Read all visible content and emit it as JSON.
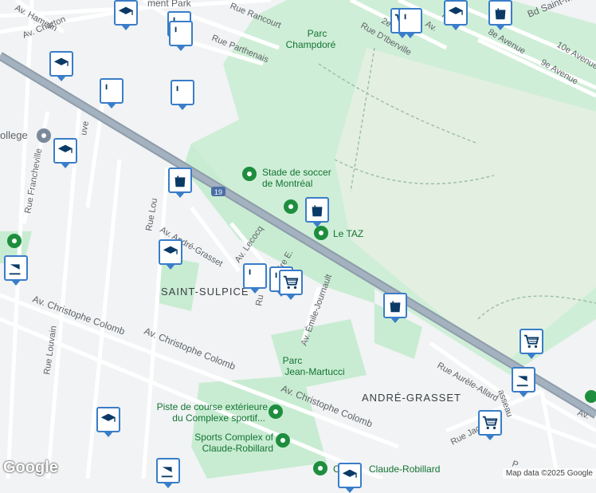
{
  "labels": {
    "street_hamelin": "Av. Hamelin",
    "street_charton": "Av. Charton",
    "street_rancourt": "Rue Rancourt",
    "street_parthenais": "Rue Parthenais",
    "street_iberville": "Rue D'Iberville",
    "street_2e": "2e",
    "street_7e": "7e",
    "street_av": "Av.",
    "street_8e": "8e Avenue",
    "street_9e": "9e Avenue",
    "street_10e": "10e Avenue",
    "street_stmichel": "Bd Saint-Michel",
    "street_louvain": "Rue Louvain",
    "street_lou": "Rue Lou",
    "street_francheville": "Rue Francheville",
    "street_uve": "uve",
    "street_andregrasset": "Av. André-Grasset",
    "street_lecocq": "Av. Lecocq",
    "street_ire": "ire E.",
    "street_ru": "Ru",
    "street_journault": "Av. Émile-Journault",
    "street_colomb1": "Av. Christophe Colomb",
    "street_colomb2": "Av. Christophe Colomb",
    "street_colomb3": "Av. Christophe Colomb",
    "street_allard": "Rue Aurèle-Allard",
    "street_jacques": "Rue Jac",
    "street_rasseau": "asseau",
    "street_av_right": "Av.",
    "street_p": "P",
    "street_ollege": "ollege",
    "hwy_19": "19",
    "hood_stsulpice": "SAINT-SULPICE",
    "hood_andregrasset": "ANDRÉ-GRASSET",
    "park_champdore_1": "Parc",
    "park_champdore_2": "Champdoré",
    "park_martucci_1": "Parc",
    "park_martucci_2": "Jean-Martucci",
    "poi_stade_1": "Stade de soccer",
    "poi_stade_2": "de Montréal",
    "poi_taz": "Le TAZ",
    "poi_piste_1": "Piste de course extérieure",
    "poi_piste_2": "du Complexe sportif...",
    "poi_sports_1": "Sports Complex of",
    "poi_sports_2": "Claude-Robillard",
    "poi_robillard": "Claude-Robillard",
    "poi_c": "C",
    "top_park": "ment Park"
  },
  "markers": [
    {
      "type": "school",
      "icon": "graduation-cap-icon"
    },
    {
      "type": "restaurant",
      "icon": "fork-knife-icon"
    },
    {
      "type": "restaurant",
      "icon": "fork-knife-icon"
    },
    {
      "type": "school",
      "icon": "graduation-cap-icon"
    },
    {
      "type": "restaurant",
      "icon": "fork-knife-icon"
    },
    {
      "type": "restaurant",
      "icon": "fork-knife-icon"
    },
    {
      "type": "school",
      "icon": "graduation-cap-icon"
    },
    {
      "type": "shopping",
      "icon": "shopping-bag-icon"
    },
    {
      "type": "shopping",
      "icon": "shopping-bag-icon"
    },
    {
      "type": "school",
      "icon": "graduation-cap-icon"
    },
    {
      "type": "cafe",
      "icon": "coffee-cup-icon"
    },
    {
      "type": "restaurant",
      "icon": "fork-knife-icon"
    },
    {
      "type": "restaurant",
      "icon": "fork-knife-icon"
    },
    {
      "type": "grocery",
      "icon": "shopping-cart-icon"
    },
    {
      "type": "shopping",
      "icon": "shopping-bag-icon"
    },
    {
      "type": "grocery",
      "icon": "shopping-cart-icon"
    },
    {
      "type": "cafe",
      "icon": "coffee-cup-icon"
    },
    {
      "type": "grocery",
      "icon": "shopping-cart-icon"
    },
    {
      "type": "school",
      "icon": "graduation-cap-icon"
    },
    {
      "type": "cafe",
      "icon": "coffee-cup-icon"
    },
    {
      "type": "school",
      "icon": "graduation-cap-icon"
    },
    {
      "type": "school",
      "icon": "graduation-cap-icon"
    },
    {
      "type": "grocery",
      "icon": "shopping-cart-icon"
    },
    {
      "type": "shopping",
      "icon": "shopping-bag-icon"
    },
    {
      "type": "restaurant",
      "icon": "fork-knife-icon"
    }
  ],
  "branding": {
    "logo": "Google",
    "attribution": "Map data ©2025 Google"
  },
  "colors": {
    "marker_border": "#3a7dc9",
    "marker_icon": "#0b3a66",
    "park": "#c8ecd2",
    "highway": "#8e9cab",
    "park_text": "#137333"
  }
}
